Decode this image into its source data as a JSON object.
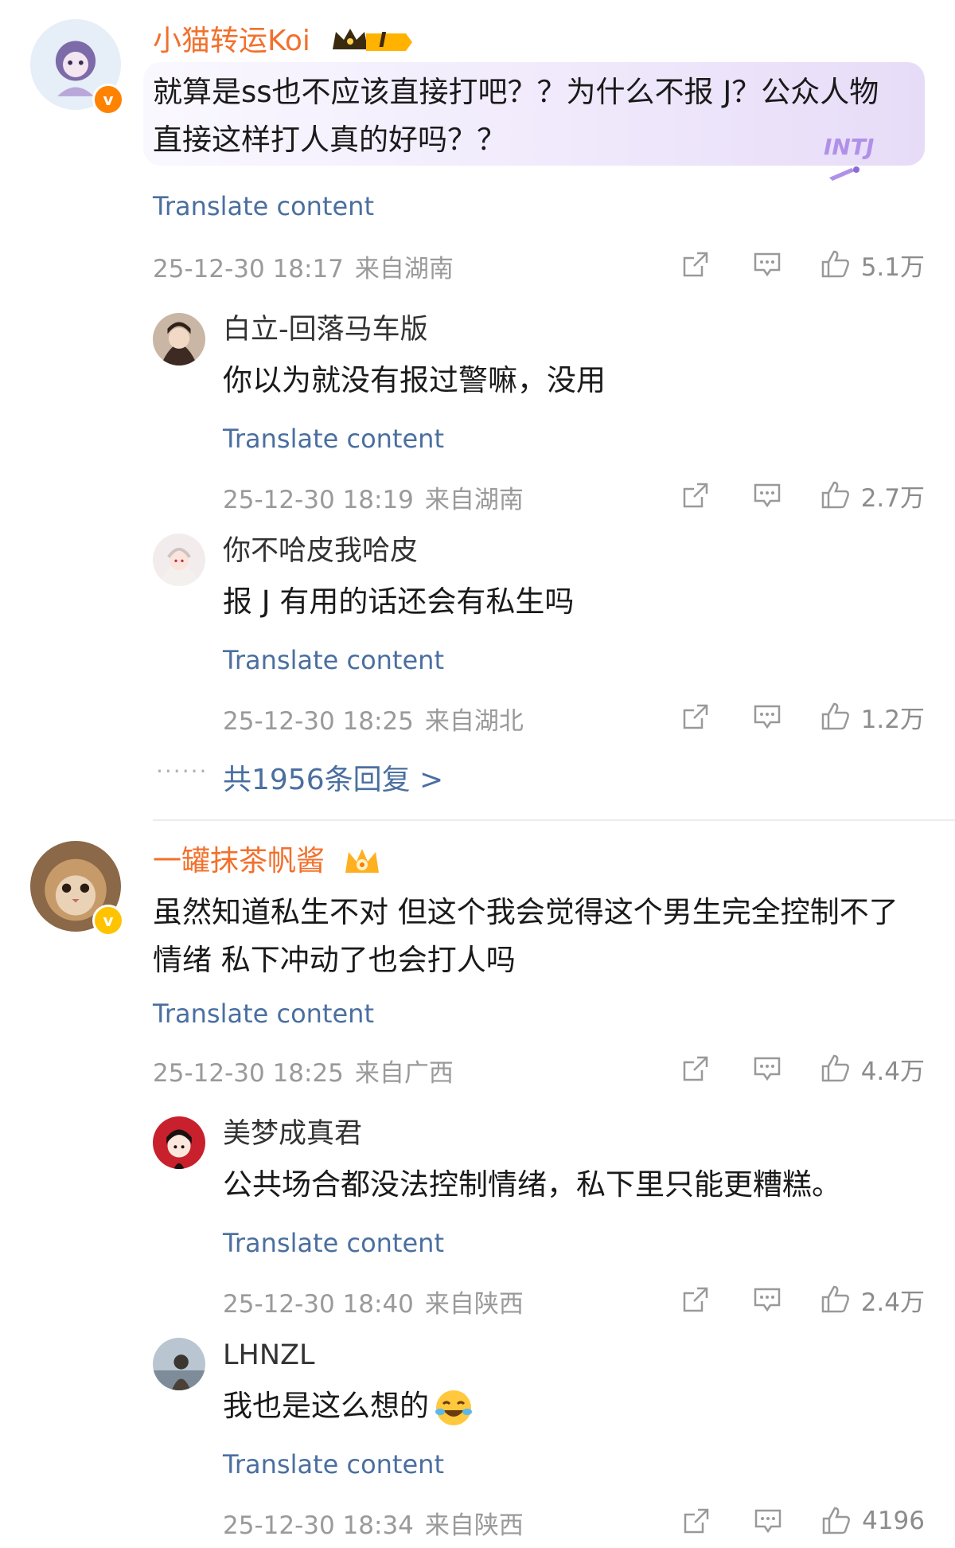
{
  "comments": [
    {
      "username": "小猫转运Koi",
      "badge_level": "I",
      "bubble_tag": "INTJ",
      "text": "就算是ss也不应该直接打吧？？为什么不报 J？公众人物直接这样打人真的好吗？？",
      "translate": "Translate content",
      "date": "25-12-30 18:17",
      "location": "来自湖南",
      "likes": "5.1万",
      "verified": "v",
      "replies": [
        {
          "username": "白立-回落马车版",
          "text": "你以为就没有报过警嘛，没用",
          "translate": "Translate content",
          "date": "25-12-30 18:19",
          "location": "来自湖南",
          "likes": "2.7万"
        },
        {
          "username": "你不哈皮我哈皮",
          "text": "报 J 有用的话还会有私生吗",
          "translate": "Translate content",
          "date": "25-12-30 18:25",
          "location": "来自湖北",
          "likes": "1.2万"
        }
      ],
      "more_dots": "······",
      "more_replies": "共1956条回复 >"
    },
    {
      "username": "一罐抹茶帆酱",
      "text": "虽然知道私生不对 但这个我会觉得这个男生完全控制不了情绪 私下冲动了也会打人吗",
      "translate": "Translate content",
      "date": "25-12-30 18:25",
      "location": "来自广西",
      "likes": "4.4万",
      "verified": "v",
      "replies": [
        {
          "username": "美梦成真君",
          "text": "公共场合都没法控制情绪，私下里只能更糟糕。",
          "translate": "Translate content",
          "date": "25-12-30 18:40",
          "location": "来自陕西",
          "likes": "2.4万"
        },
        {
          "username": "LHNZL",
          "text": "我也是这么想的",
          "emoji": "crying-laughing-emoji",
          "translate": "Translate content",
          "date": "25-12-30 18:34",
          "location": "来自陕西",
          "likes": "4196"
        }
      ]
    }
  ],
  "colors": {
    "username_orange": "#f2702c",
    "link_blue": "#4a6fa0",
    "meta_gray": "#9a9a9a",
    "vip_orange": "#ff8200",
    "vip_gold": "#ffc300"
  }
}
